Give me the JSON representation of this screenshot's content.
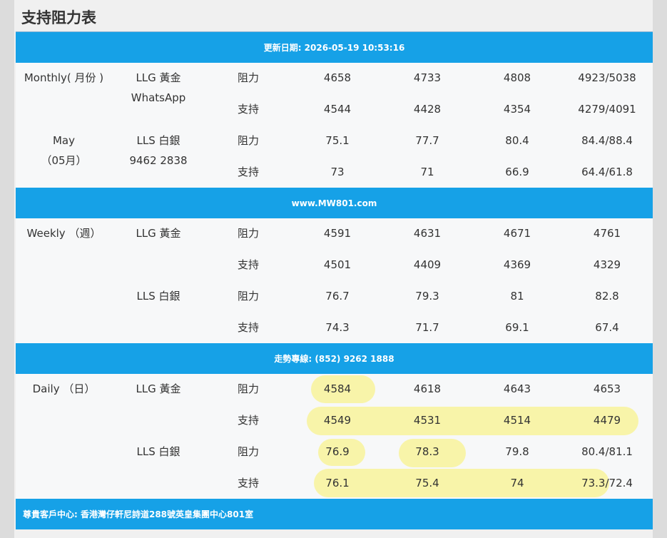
{
  "page": {
    "title": "支持阻力表"
  },
  "bands": {
    "update": "更新日期: 2026-05-19 10:53:16",
    "site": "www.MW801.com",
    "hotline": "走勢專線: (852) 9262 1888",
    "footer": "尊貴客戶中心: 香港灣仔軒尼詩道288號英皇集團中心801室"
  },
  "monthly": {
    "period_line1": "Monthly( 月份 )",
    "period_line2": "May",
    "period_line3": "（05月）",
    "gold_label": "LLG 黃金",
    "gold_sub": "WhatsApp",
    "silver_label": "LLS 白銀",
    "silver_sub": "9462 2838",
    "rows": [
      {
        "type": "阻力",
        "v": [
          "4658",
          "4733",
          "4808",
          "4923/5038"
        ]
      },
      {
        "type": "支持",
        "v": [
          "4544",
          "4428",
          "4354",
          "4279/4091"
        ]
      },
      {
        "type": "阻力",
        "v": [
          "75.1",
          "77.7",
          "80.4",
          "84.4/88.4"
        ]
      },
      {
        "type": "支持",
        "v": [
          "73",
          "71",
          "66.9",
          "64.4/61.8"
        ]
      }
    ]
  },
  "weekly": {
    "period": "Weekly （週）",
    "gold_label": "LLG 黃金",
    "silver_label": "LLS 白銀",
    "rows": [
      {
        "type": "阻力",
        "v": [
          "4591",
          "4631",
          "4671",
          "4761"
        ]
      },
      {
        "type": "支持",
        "v": [
          "4501",
          "4409",
          "4369",
          "4329"
        ]
      },
      {
        "type": "阻力",
        "v": [
          "76.7",
          "79.3",
          "81",
          "82.8"
        ]
      },
      {
        "type": "支持",
        "v": [
          "74.3",
          "71.7",
          "69.1",
          "67.4"
        ]
      }
    ]
  },
  "daily": {
    "period": "Daily （日）",
    "gold_label": "LLG 黃金",
    "silver_label": "LLS 白銀",
    "rows": [
      {
        "type": "阻力",
        "v": [
          "4584",
          "4618",
          "4643",
          "4653"
        ]
      },
      {
        "type": "支持",
        "v": [
          "4549",
          "4531",
          "4514",
          "4479"
        ]
      },
      {
        "type": "阻力",
        "v": [
          "76.9",
          "78.3",
          "79.8",
          "80.4/81.1"
        ]
      },
      {
        "type": "支持",
        "v": [
          "76.1",
          "75.4",
          "74",
          "73.3/72.4"
        ]
      }
    ]
  },
  "colors": {
    "band": "#16a1e7",
    "highlight": "#f8f278",
    "text": "#333333"
  }
}
